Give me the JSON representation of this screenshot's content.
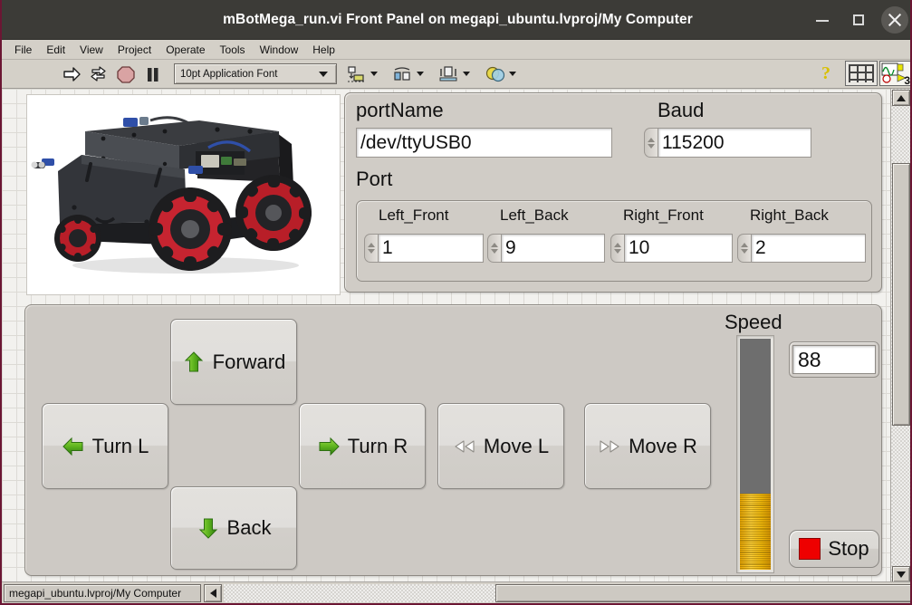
{
  "window": {
    "title": "mBotMega_run.vi Front Panel on megapi_ubuntu.lvproj/My Computer",
    "minimize_label": "–",
    "maximize_label": "□",
    "close_label": "✕"
  },
  "menu": {
    "items": [
      {
        "label": "File"
      },
      {
        "label": "Edit"
      },
      {
        "label": "View"
      },
      {
        "label": "Project"
      },
      {
        "label": "Operate"
      },
      {
        "label": "Tools"
      },
      {
        "label": "Window"
      },
      {
        "label": "Help"
      }
    ]
  },
  "toolbar": {
    "run_icon": "run-arrow-icon",
    "run_continuous_icon": "run-continuously-icon",
    "abort_icon": "abort-execution-icon",
    "pause_icon": "pause-icon",
    "font_selector": "10pt Application Font",
    "align_icon": "align-objects-icon",
    "distribute_icon": "distribute-objects-icon",
    "resize_icon": "resize-objects-icon",
    "reorder_icon": "reorder-objects-icon",
    "help_icon": "context-help-icon",
    "window_grid_icon": "window-grid-icon",
    "labview_icon": "labview-waveform-icon",
    "labview_icon_badge": "3"
  },
  "panel": {
    "photo_alt": "mecanum-wheel-robot-photo",
    "serial": {
      "port_name_label": "portName",
      "port_name_value": "/dev/ttyUSB0",
      "baud_label": "Baud",
      "baud_value": "115200",
      "port_group_label": "Port",
      "ports": [
        {
          "label": "Left_Front",
          "value": "1"
        },
        {
          "label": "Left_Back",
          "value": "9"
        },
        {
          "label": "Right_Front",
          "value": "10"
        },
        {
          "label": "Right_Back",
          "value": "2"
        }
      ]
    },
    "controls": {
      "buttons": [
        {
          "name": "forward-button",
          "label": "Forward",
          "icon": "arrow-up-green-icon"
        },
        {
          "name": "turn-left-button",
          "label": "Turn L",
          "icon": "arrow-left-green-icon"
        },
        {
          "name": "turn-right-button",
          "label": "Turn R",
          "icon": "arrow-right-green-icon"
        },
        {
          "name": "move-left-button",
          "label": "Move L",
          "icon": "double-triangle-left-icon"
        },
        {
          "name": "move-right-button",
          "label": "Move R",
          "icon": "double-triangle-right-icon"
        },
        {
          "name": "back-button",
          "label": "Back",
          "icon": "arrow-down-green-icon"
        }
      ],
      "speed_label": "Speed",
      "speed_value": "88",
      "speed_percent": 33,
      "speed_min": 0,
      "speed_max": 255,
      "stop_label": "Stop",
      "stop_led_color": "#ee0000"
    }
  },
  "statusbar": {
    "context": "megapi_ubuntu.lvproj/My Computer",
    "scroll_left_icon": "scroll-left-arrow-icon",
    "scroll_up_icon": "scroll-up-arrow-icon",
    "scroll_down_icon": "scroll-down-arrow-icon"
  },
  "colors": {
    "titlebar": "#3c3b37",
    "window_border": "#6b1633",
    "chrome": "#d4d0c8",
    "panel": "#cdc9c4",
    "arrow_green": "#5fb320",
    "speed_fill": "#f5bb0b",
    "stop_red": "#ee0000"
  }
}
